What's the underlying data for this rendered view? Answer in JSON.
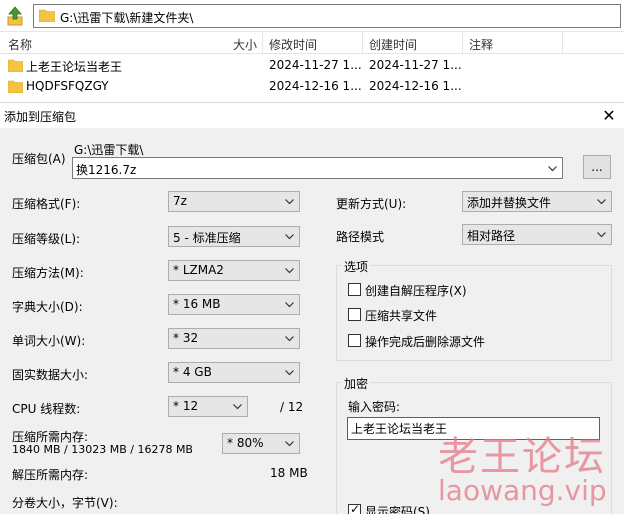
{
  "explorer": {
    "address": "G:\\迅雷下载\\新建文件夹\\",
    "columns": {
      "name": "名称",
      "size": "大小",
      "modified": "修改时间",
      "created": "创建时间",
      "comment": "注释"
    },
    "files": [
      {
        "name": "上老王论坛当老王",
        "modified": "2024-11-27 1...",
        "created": "2024-11-27 1..."
      },
      {
        "name": "HQDFSFQZGY",
        "modified": "2024-12-16 1...",
        "created": "2024-12-16 1..."
      }
    ]
  },
  "dialog": {
    "title": "添加到压缩包",
    "archive": {
      "label": "压缩包(A)",
      "path": "G:\\迅雷下载\\",
      "filename": "换1216.7z",
      "browse_label": "..."
    },
    "left": {
      "format": {
        "label": "压缩格式(F):",
        "value": "7z"
      },
      "level": {
        "label": "压缩等级(L):",
        "value": "5 - 标准压缩"
      },
      "method": {
        "label": "压缩方法(M):",
        "value": "* LZMA2"
      },
      "dict": {
        "label": "字典大小(D):",
        "value": "* 16 MB"
      },
      "word": {
        "label": "单词大小(W):",
        "value": "* 32"
      },
      "solid": {
        "label": "固实数据大小:",
        "value": "* 4 GB"
      },
      "cpu": {
        "label": "CPU 线程数:",
        "value": "* 12",
        "max": "/ 12"
      },
      "mem_compress": {
        "label": "压缩所需内存:",
        "detail": "1840 MB / 13023 MB / 16278 MB",
        "value": "* 80%"
      },
      "mem_decompress": {
        "label": "解压所需内存:",
        "value": "18 MB"
      },
      "split": {
        "label": "分卷大小，字节(V):"
      }
    },
    "right": {
      "update": {
        "label": "更新方式(U):",
        "value": "添加并替换文件"
      },
      "path_mode": {
        "label": "路径模式",
        "value": "相对路径"
      },
      "options": {
        "title": "选项",
        "sfx": "创建自解压程序(X)",
        "shared": "压缩共享文件",
        "delete": "操作完成后删除源文件"
      },
      "encryption": {
        "title": "加密",
        "password_label": "输入密码:",
        "password_value": "上老王论坛当老王",
        "show_password": "显示密码(S)"
      }
    }
  },
  "watermark": {
    "cn": "老王论坛",
    "en": "laowang.vip"
  },
  "colors": {
    "folder": "#f3c343",
    "up_arrow": "#4a9a2c",
    "watermark": "#e67887"
  }
}
